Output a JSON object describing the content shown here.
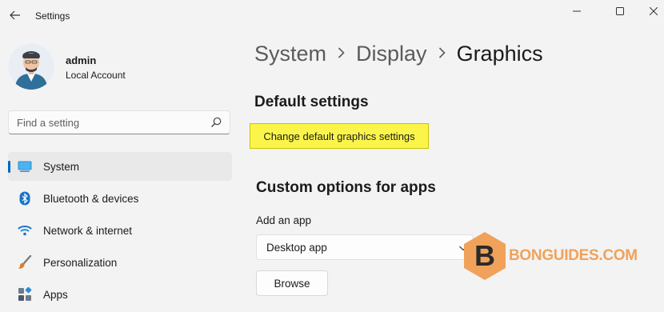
{
  "window": {
    "title": "Settings"
  },
  "profile": {
    "name": "admin",
    "account_type": "Local Account"
  },
  "search": {
    "placeholder": "Find a setting",
    "value": ""
  },
  "sidebar": {
    "items": [
      {
        "label": "System",
        "icon": "monitor-icon",
        "active": true
      },
      {
        "label": "Bluetooth & devices",
        "icon": "bluetooth-icon",
        "active": false
      },
      {
        "label": "Network & internet",
        "icon": "wifi-icon",
        "active": false
      },
      {
        "label": "Personalization",
        "icon": "brush-icon",
        "active": false
      },
      {
        "label": "Apps",
        "icon": "apps-icon",
        "active": false
      }
    ]
  },
  "breadcrumb": {
    "items": [
      "System",
      "Display",
      "Graphics"
    ]
  },
  "main": {
    "default_settings_title": "Default settings",
    "change_default_link": "Change default graphics settings",
    "custom_options_title": "Custom options for apps",
    "add_app_label": "Add an app",
    "app_type_selected": "Desktop app",
    "browse_label": "Browse"
  },
  "watermark": {
    "letter": "B",
    "text": "BONGUIDES.COM"
  },
  "colors": {
    "accent": "#0067c0",
    "highlight": "#fbf54b",
    "watermark": "#f0a25a"
  }
}
